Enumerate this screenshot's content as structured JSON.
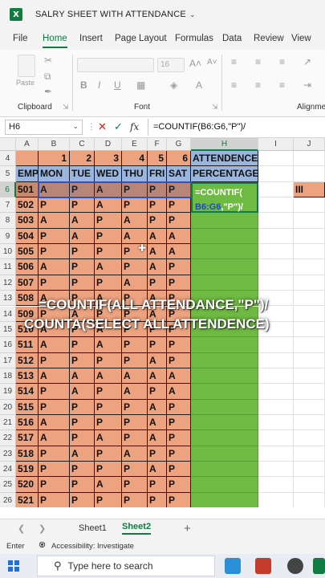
{
  "window": {
    "title": "SALRY SHEET WITH ATTENDANCE"
  },
  "menu": [
    "File",
    "Home",
    "Insert",
    "Page Layout",
    "Formulas",
    "Data",
    "Review",
    "View"
  ],
  "ribbon": {
    "clipboard_label": "Clipboard",
    "paste_label": "Paste",
    "font_label": "Font",
    "alignment_label": "Alignmen",
    "font_size": "16"
  },
  "formula_bar": {
    "name_box": "H6",
    "fx": "fx",
    "formula": "=COUNTIF(B6:G6,\"P\")/"
  },
  "columns": [
    "A",
    "B",
    "C",
    "D",
    "E",
    "F",
    "G",
    "H",
    "I",
    "J"
  ],
  "row_numbers": [
    "4",
    "5",
    "6",
    "7",
    "8",
    "9",
    "10",
    "11",
    "12",
    "13",
    "14",
    "15",
    "16",
    "17",
    "18",
    "19",
    "20",
    "21",
    "22",
    "23",
    "24",
    "25",
    "26"
  ],
  "header_row4": [
    "1",
    "2",
    "3",
    "4",
    "5",
    "6"
  ],
  "header_row4_h": "ATTENDENCE",
  "header_row5": [
    "EMP",
    "MON",
    "TUE",
    "WED",
    "THU",
    "FRI",
    "SAT"
  ],
  "header_row5_h": "PERCENTAGE",
  "j6_text": "III",
  "employees": [
    {
      "id": "501",
      "days": [
        "A",
        "P",
        "A",
        "P",
        "P",
        "P"
      ]
    },
    {
      "id": "502",
      "days": [
        "P",
        "P",
        "A",
        "P",
        "P",
        "P"
      ]
    },
    {
      "id": "503",
      "days": [
        "A",
        "A",
        "P",
        "A",
        "P",
        "P"
      ]
    },
    {
      "id": "504",
      "days": [
        "P",
        "A",
        "P",
        "A",
        "A",
        "A"
      ]
    },
    {
      "id": "505",
      "days": [
        "P",
        "P",
        "P",
        "P",
        "A",
        "A"
      ]
    },
    {
      "id": "506",
      "days": [
        "A",
        "P",
        "A",
        "P",
        "A",
        "P"
      ]
    },
    {
      "id": "507",
      "days": [
        "P",
        "P",
        "P",
        "A",
        "P",
        "P"
      ]
    },
    {
      "id": "508",
      "days": [
        "A",
        "P",
        "A",
        "P",
        "A",
        "P"
      ]
    },
    {
      "id": "509",
      "days": [
        "P",
        "A",
        "P",
        "P",
        "A",
        "P"
      ]
    },
    {
      "id": "510",
      "days": [
        "A",
        "P",
        "A",
        "P",
        "P",
        "P"
      ]
    },
    {
      "id": "511",
      "days": [
        "A",
        "P",
        "A",
        "P",
        "P",
        "P"
      ]
    },
    {
      "id": "512",
      "days": [
        "P",
        "P",
        "P",
        "P",
        "A",
        "P"
      ]
    },
    {
      "id": "513",
      "days": [
        "A",
        "A",
        "A",
        "A",
        "A",
        "A"
      ]
    },
    {
      "id": "514",
      "days": [
        "P",
        "A",
        "P",
        "A",
        "P",
        "A"
      ]
    },
    {
      "id": "515",
      "days": [
        "P",
        "P",
        "P",
        "P",
        "A",
        "P"
      ]
    },
    {
      "id": "516",
      "days": [
        "A",
        "P",
        "P",
        "P",
        "A",
        "P"
      ]
    },
    {
      "id": "517",
      "days": [
        "A",
        "P",
        "A",
        "P",
        "A",
        "P"
      ]
    },
    {
      "id": "518",
      "days": [
        "P",
        "A",
        "P",
        "A",
        "P",
        "P"
      ]
    },
    {
      "id": "519",
      "days": [
        "P",
        "P",
        "P",
        "P",
        "A",
        "P"
      ]
    },
    {
      "id": "520",
      "days": [
        "P",
        "P",
        "A",
        "P",
        "P",
        "P"
      ]
    },
    {
      "id": "521",
      "days": [
        "P",
        "P",
        "P",
        "P",
        "P",
        "P"
      ]
    }
  ],
  "active_cell": {
    "line1": "=COUNTIF(",
    "line2_ref": "B6:G6",
    "line2_rest": ",\"P\")/"
  },
  "overlay": {
    "line1": "=COUNTIF(ALL ATTENDANCE,\"P\")/",
    "line2": "COUNTA(SELECT ALL ATTENDENCE)"
  },
  "sheets": [
    "Sheet1",
    "Sheet2"
  ],
  "active_sheet": "Sheet2",
  "status": {
    "mode": "Enter",
    "accessibility": "Accessibility: Investigate"
  },
  "taskbar": {
    "search_placeholder": "Type here to search"
  }
}
